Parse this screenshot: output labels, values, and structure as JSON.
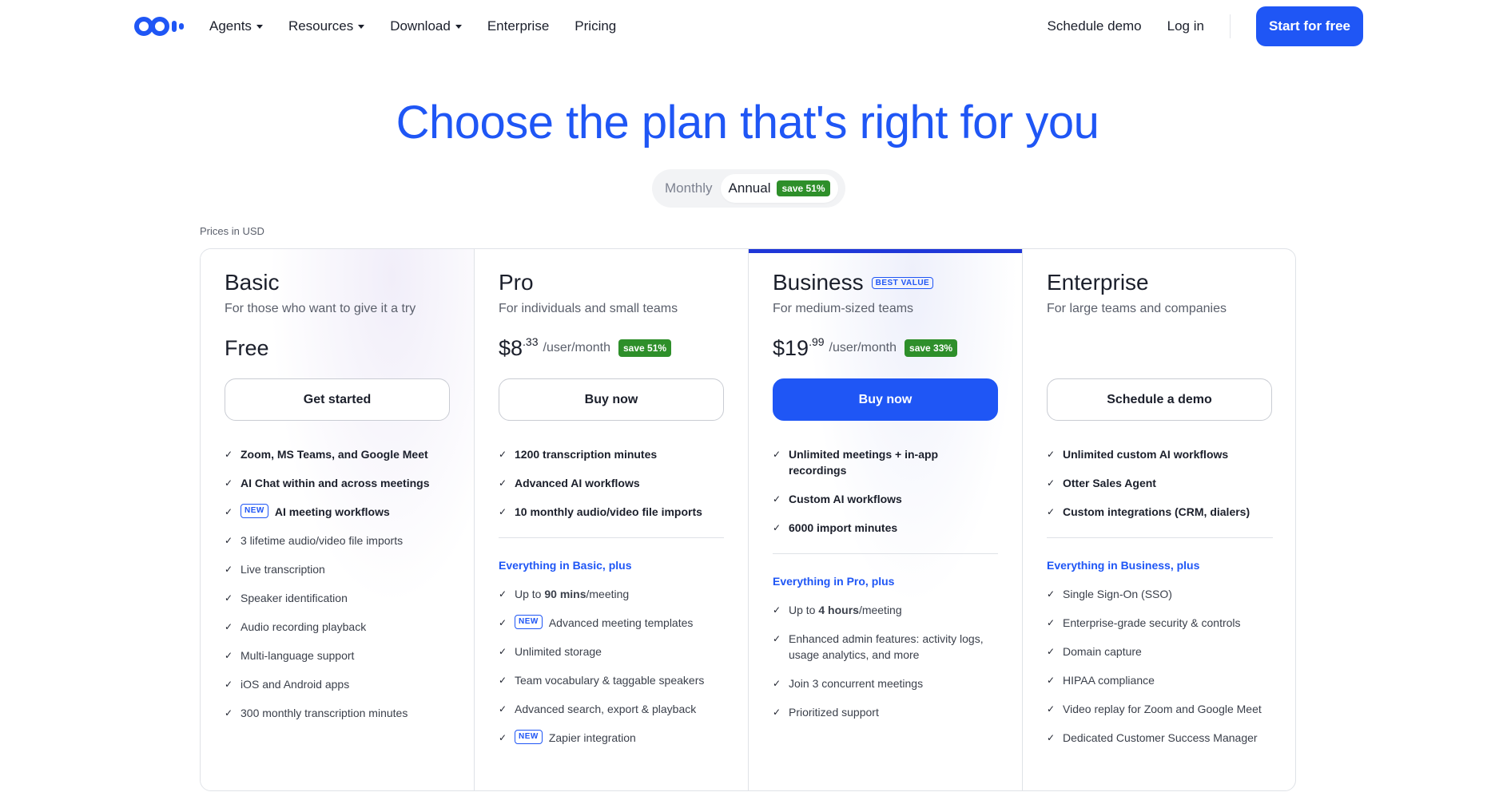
{
  "nav": {
    "links": [
      {
        "label": "Agents",
        "has_caret": true
      },
      {
        "label": "Resources",
        "has_caret": true
      },
      {
        "label": "Download",
        "has_caret": true
      },
      {
        "label": "Enterprise",
        "has_caret": false
      },
      {
        "label": "Pricing",
        "has_caret": false
      }
    ],
    "schedule_demo": "Schedule demo",
    "log_in": "Log in",
    "start_free": "Start for free",
    "logo_icon": "otter-logo"
  },
  "hero": {
    "title": "Choose the plan that's right for you",
    "toggle": {
      "monthly": "Monthly",
      "annual": "Annual",
      "save": "save 51%",
      "selected": "Annual"
    },
    "prices_note": "Prices in USD"
  },
  "plans": [
    {
      "name": "Basic",
      "desc": "For those who want to give it a try",
      "price": "Free",
      "cta": "Get started",
      "features_main": [
        {
          "text": "Zoom, MS Teams, and Google Meet",
          "new": false
        },
        {
          "text": "AI Chat within and across meetings",
          "new": false
        },
        {
          "text": "AI meeting workflows",
          "new": true
        }
      ],
      "features_more": [
        "3 lifetime audio/video file imports",
        "Live transcription",
        "Speaker identification",
        "Audio recording playback",
        "Multi-language support",
        "iOS and Android apps",
        "300 monthly transcription minutes"
      ]
    },
    {
      "name": "Pro",
      "desc": "For individuals and small teams",
      "price_dollars": "$8",
      "price_cents": ".33",
      "per": "/user/month",
      "save": "save 51%",
      "cta": "Buy now",
      "features_main": [
        "1200 transcription minutes",
        "Advanced AI workflows",
        "10 monthly audio/video file imports"
      ],
      "section_label": "Everything in Basic, plus",
      "features_more": [
        {
          "pre": "Up to ",
          "bold": "90 mins",
          "post": "/meeting",
          "new": false
        },
        {
          "pre": "Advanced meeting templates",
          "bold": "",
          "post": "",
          "new": true
        },
        {
          "pre": "Unlimited storage",
          "bold": "",
          "post": "",
          "new": false
        },
        {
          "pre": "Team vocabulary & taggable speakers",
          "bold": "",
          "post": "",
          "new": false
        },
        {
          "pre": "Advanced search, export & playback",
          "bold": "",
          "post": "",
          "new": false
        },
        {
          "pre": "Zapier integration",
          "bold": "",
          "post": "",
          "new": true
        }
      ]
    },
    {
      "name": "Business",
      "badge": "BEST VALUE",
      "desc": "For medium-sized teams",
      "price_dollars": "$19",
      "price_cents": ".99",
      "per": "/user/month",
      "save": "save 33%",
      "cta": "Buy now",
      "features_main": [
        "Unlimited meetings + in-app recordings",
        "Custom AI workflows",
        "6000 import minutes"
      ],
      "section_label": "Everything in Pro, plus",
      "features_more": [
        {
          "pre": "Up to ",
          "bold": "4 hours",
          "post": "/meeting"
        },
        {
          "pre": "Enhanced admin features: activity logs, usage analytics, and more",
          "bold": "",
          "post": ""
        },
        {
          "pre": "Join 3 concurrent meetings",
          "bold": "",
          "post": ""
        },
        {
          "pre": "Prioritized support",
          "bold": "",
          "post": ""
        }
      ]
    },
    {
      "name": "Enterprise",
      "desc": "For large teams and companies",
      "cta": "Schedule a demo",
      "features_main": [
        "Unlimited custom AI workflows",
        "Otter Sales Agent",
        "Custom integrations (CRM, dialers)"
      ],
      "section_label": "Everything in Business, plus",
      "features_more": [
        "Single Sign-On (SSO)",
        "Enterprise-grade security & controls",
        "Domain capture",
        "HIPAA compliance",
        "Video replay for Zoom and Google Meet",
        "Dedicated Customer Success Manager"
      ]
    }
  ],
  "new_tag": "NEW",
  "check_icon": "check-icon",
  "colors": {
    "accent": "#1f56f5",
    "save_green": "#2e8f2a",
    "business_top": "#1f37d8"
  }
}
